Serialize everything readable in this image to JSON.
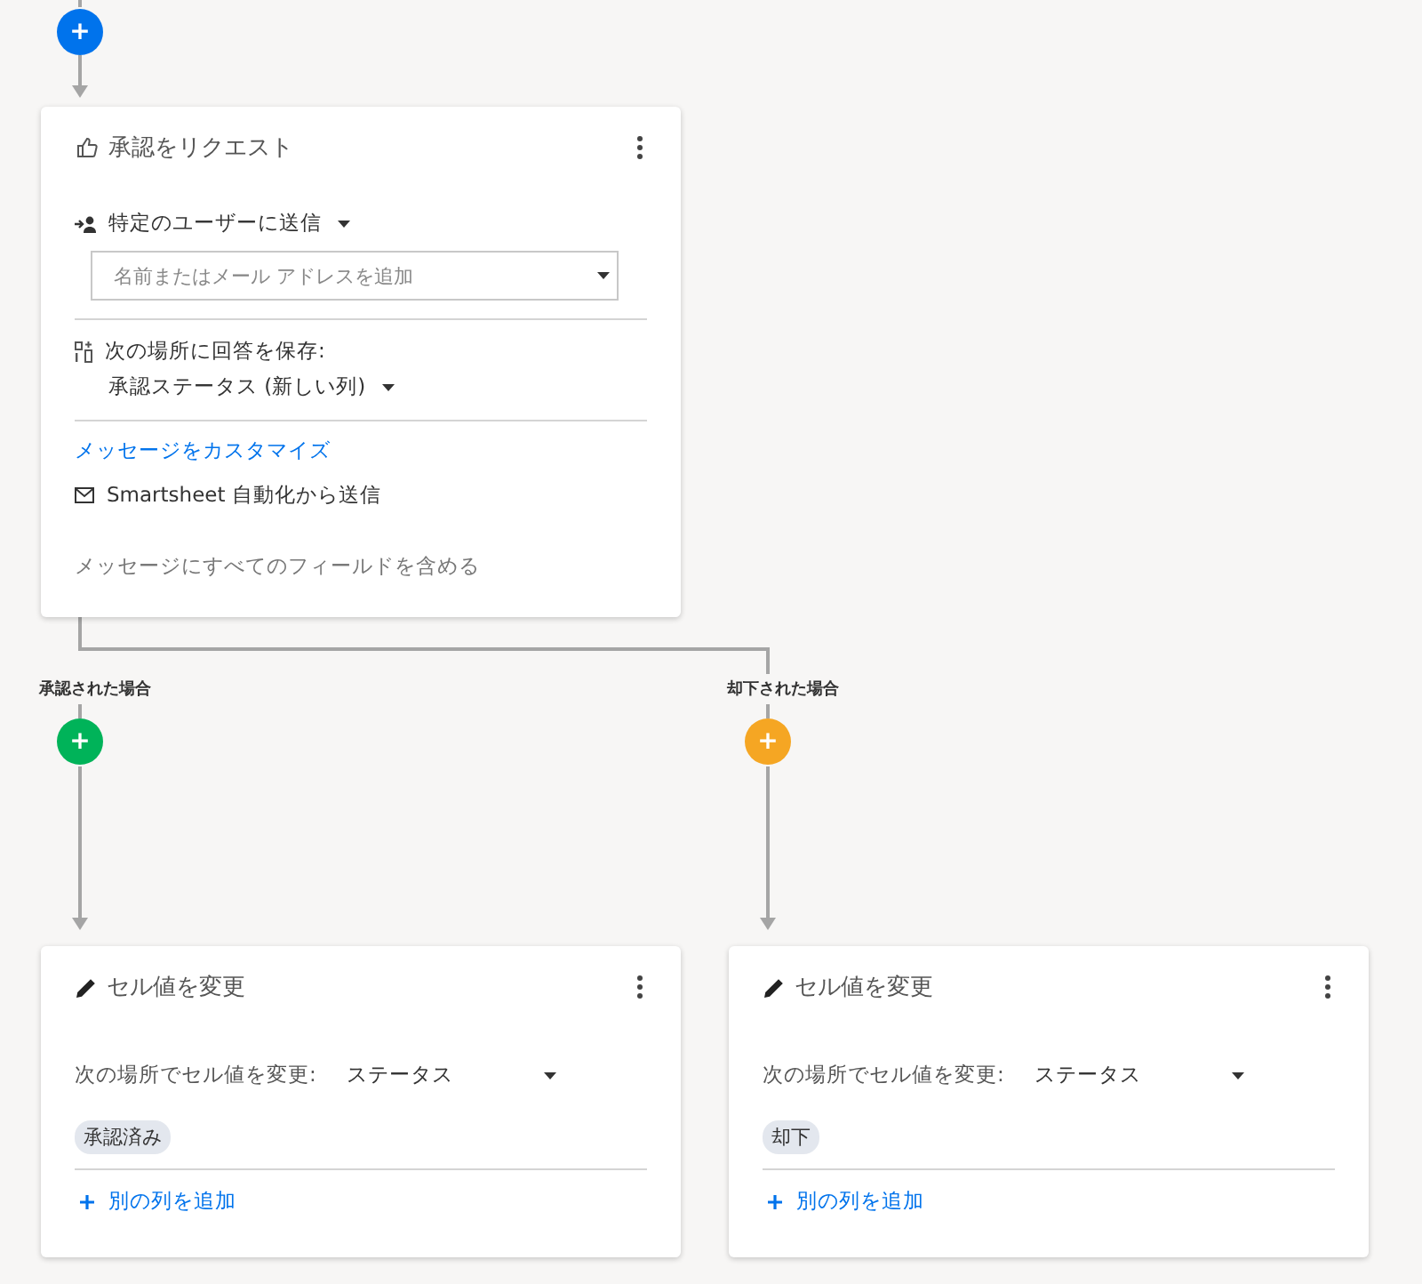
{
  "top_add_button": {
    "label": "+"
  },
  "approval_card": {
    "title": "承認をリクエスト",
    "recipient_mode": "特定のユーザーに送信",
    "recipient_field": {
      "placeholder": "名前またはメール アドレスを追加"
    },
    "save_label": "次の場所に回答を保存:",
    "save_column": "承認ステータス (新しい列)",
    "customize_link": "メッセージをカスタマイズ",
    "sender": "Smartsheet 自動化から送信",
    "include_fields": "メッセージにすべてのフィールドを含める"
  },
  "branches": [
    {
      "label": "承認された場合",
      "add_label": "+",
      "color": "#00b359",
      "action_card": {
        "title": "セル値を変更",
        "field_label": "次の場所でセル値を変更:",
        "field_value": "ステータス",
        "chips": [
          "承認済み"
        ],
        "add_column": "別の列を追加"
      }
    },
    {
      "label": "却下された場合",
      "add_label": "+",
      "color": "#f5a623",
      "action_card": {
        "title": "セル値を変更",
        "field_label": "次の場所でセル値を変更:",
        "field_value": "ステータス",
        "chips": [
          "却下"
        ],
        "add_column": "別の列を追加"
      }
    }
  ]
}
